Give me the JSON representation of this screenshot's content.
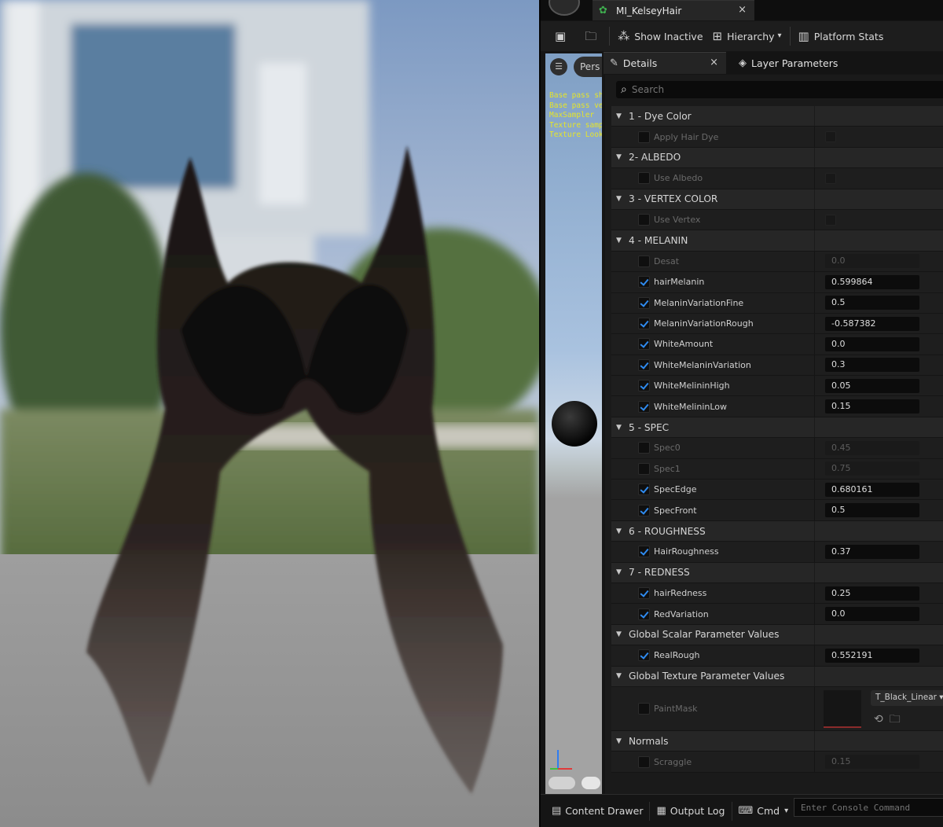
{
  "window": {
    "asset_tab_label": "MI_KelseyHair",
    "close_glyph": "×"
  },
  "toolbar": {
    "show_inactive": "Show Inactive",
    "hierarchy": "Hierarchy",
    "platform_stats": "Platform Stats"
  },
  "preview": {
    "view_mode": "Pers",
    "stats_lines": [
      "Base pass sh",
      "Base pass ve",
      "MaxSampler",
      "Texture samp",
      "Texture Looku"
    ]
  },
  "panel_tabs": {
    "details": "Details",
    "layer_parameters": "Layer Parameters"
  },
  "search": {
    "placeholder": "Search"
  },
  "groups": [
    {
      "label": "1 - Dye Color",
      "props": [
        {
          "name": "Apply Hair Dye",
          "enabled": false,
          "kind": "bool",
          "value": ""
        }
      ]
    },
    {
      "label": "2- ALBEDO",
      "props": [
        {
          "name": "Use Albedo",
          "enabled": false,
          "kind": "bool",
          "value": ""
        }
      ]
    },
    {
      "label": "3 - VERTEX COLOR",
      "props": [
        {
          "name": "Use Vertex",
          "enabled": false,
          "kind": "bool",
          "value": ""
        }
      ]
    },
    {
      "label": "4 - MELANIN",
      "props": [
        {
          "name": "Desat",
          "enabled": false,
          "kind": "scalar",
          "value": "0.0"
        },
        {
          "name": "hairMelanin",
          "enabled": true,
          "kind": "scalar",
          "value": "0.599864"
        },
        {
          "name": "MelaninVariationFine",
          "enabled": true,
          "kind": "scalar",
          "value": "0.5"
        },
        {
          "name": "MelaninVariationRough",
          "enabled": true,
          "kind": "scalar",
          "value": "-0.587382"
        },
        {
          "name": "WhiteAmount",
          "enabled": true,
          "kind": "scalar",
          "value": "0.0"
        },
        {
          "name": "WhiteMelaninVariation",
          "enabled": true,
          "kind": "scalar",
          "value": "0.3"
        },
        {
          "name": "WhiteMelininHigh",
          "enabled": true,
          "kind": "scalar",
          "value": "0.05"
        },
        {
          "name": "WhiteMelininLow",
          "enabled": true,
          "kind": "scalar",
          "value": "0.15"
        }
      ]
    },
    {
      "label": "5 - SPEC",
      "props": [
        {
          "name": "Spec0",
          "enabled": false,
          "kind": "scalar",
          "value": "0.45"
        },
        {
          "name": "Spec1",
          "enabled": false,
          "kind": "scalar",
          "value": "0.75"
        },
        {
          "name": "SpecEdge",
          "enabled": true,
          "kind": "scalar",
          "value": "0.680161"
        },
        {
          "name": "SpecFront",
          "enabled": true,
          "kind": "scalar",
          "value": "0.5"
        }
      ]
    },
    {
      "label": "6 - ROUGHNESS",
      "props": [
        {
          "name": "HairRoughness",
          "enabled": true,
          "kind": "scalar",
          "value": "0.37"
        }
      ]
    },
    {
      "label": "7 - REDNESS",
      "props": [
        {
          "name": "hairRedness",
          "enabled": true,
          "kind": "scalar",
          "value": "0.25"
        },
        {
          "name": "RedVariation",
          "enabled": true,
          "kind": "scalar",
          "value": "0.0"
        }
      ]
    },
    {
      "label": "Global Scalar Parameter Values",
      "props": [
        {
          "name": "RealRough",
          "enabled": true,
          "kind": "scalar",
          "value": "0.552191"
        }
      ]
    },
    {
      "label": "Global Texture Parameter Values",
      "props": [
        {
          "name": "PaintMask",
          "enabled": false,
          "kind": "texture",
          "value": "T_Black_Linear"
        }
      ]
    },
    {
      "label": "Normals",
      "props": [
        {
          "name": "Scraggle",
          "enabled": false,
          "kind": "scalar",
          "value": "0.15"
        }
      ]
    }
  ],
  "statusbar": {
    "content_drawer": "Content Drawer",
    "output_log": "Output Log",
    "cmd": "Cmd",
    "console_placeholder": "Enter Console Command"
  },
  "colors": {
    "check_accent": "#2f8bf0",
    "asset_icon": "#3fae4f",
    "stats_text": "#e5e52a"
  }
}
